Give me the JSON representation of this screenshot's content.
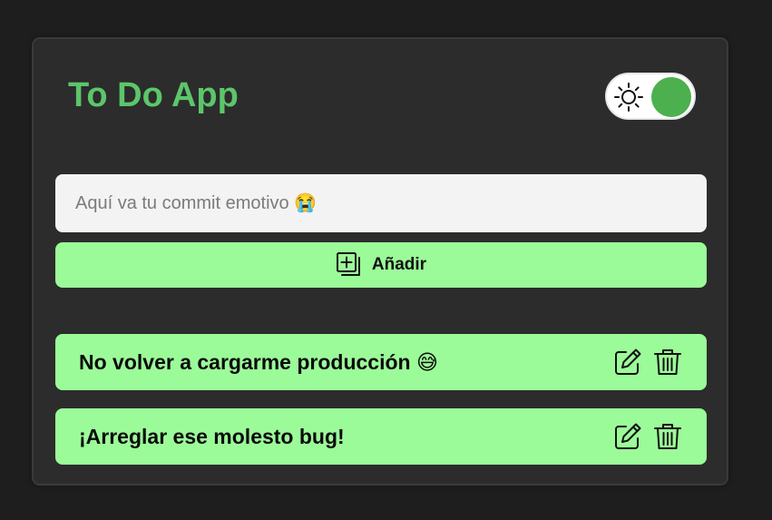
{
  "app": {
    "title": "To Do App"
  },
  "theme_toggle": {
    "icon": "sun-icon",
    "state": "dark-mode",
    "knob_color": "#4cb04f"
  },
  "input": {
    "placeholder": "Aquí va tu commit emotivo 😭",
    "value": ""
  },
  "add_button": {
    "label": "Añadir",
    "icon": "add-square-icon"
  },
  "tasks": [
    {
      "text": "No volver a cargarme producción 😅",
      "edit_icon": "edit-icon",
      "delete_icon": "trash-icon"
    },
    {
      "text": "¡Arreglar ese molesto bug!",
      "edit_icon": "edit-icon",
      "delete_icon": "trash-icon"
    }
  ],
  "colors": {
    "background": "#1e1e1e",
    "card": "#2c2c2c",
    "title": "#5cc66b",
    "accent": "#9cfb99",
    "input_bg": "#f3f3f3"
  }
}
